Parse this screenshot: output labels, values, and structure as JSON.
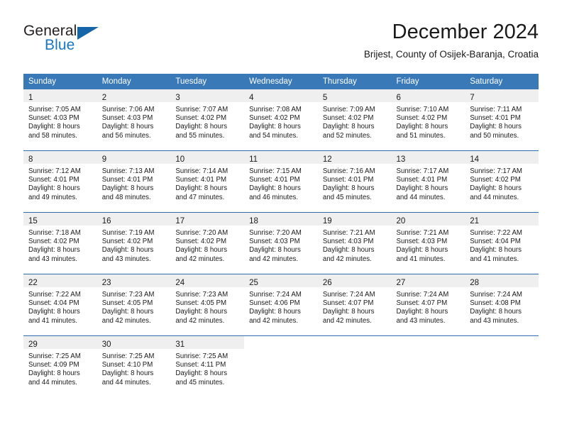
{
  "brand": {
    "name_part1": "General",
    "name_part2": "Blue",
    "logo_icon": "triangle-flag-icon",
    "accent_color": "#1878c4"
  },
  "header": {
    "month_title": "December 2024",
    "location": "Brijest, County of Osijek-Baranja, Croatia"
  },
  "theme": {
    "header_row_bg": "#3a79b8",
    "row_divider": "#2f6fad",
    "daynum_band_bg": "#efefef",
    "text_color": "#1a1a1a"
  },
  "calendar": {
    "weekday_headers": [
      "Sunday",
      "Monday",
      "Tuesday",
      "Wednesday",
      "Thursday",
      "Friday",
      "Saturday"
    ],
    "weeks": [
      [
        {
          "day": "1",
          "sunrise": "Sunrise: 7:05 AM",
          "sunset": "Sunset: 4:03 PM",
          "daylight_line1": "Daylight: 8 hours",
          "daylight_line2": "and 58 minutes."
        },
        {
          "day": "2",
          "sunrise": "Sunrise: 7:06 AM",
          "sunset": "Sunset: 4:03 PM",
          "daylight_line1": "Daylight: 8 hours",
          "daylight_line2": "and 56 minutes."
        },
        {
          "day": "3",
          "sunrise": "Sunrise: 7:07 AM",
          "sunset": "Sunset: 4:02 PM",
          "daylight_line1": "Daylight: 8 hours",
          "daylight_line2": "and 55 minutes."
        },
        {
          "day": "4",
          "sunrise": "Sunrise: 7:08 AM",
          "sunset": "Sunset: 4:02 PM",
          "daylight_line1": "Daylight: 8 hours",
          "daylight_line2": "and 54 minutes."
        },
        {
          "day": "5",
          "sunrise": "Sunrise: 7:09 AM",
          "sunset": "Sunset: 4:02 PM",
          "daylight_line1": "Daylight: 8 hours",
          "daylight_line2": "and 52 minutes."
        },
        {
          "day": "6",
          "sunrise": "Sunrise: 7:10 AM",
          "sunset": "Sunset: 4:02 PM",
          "daylight_line1": "Daylight: 8 hours",
          "daylight_line2": "and 51 minutes."
        },
        {
          "day": "7",
          "sunrise": "Sunrise: 7:11 AM",
          "sunset": "Sunset: 4:01 PM",
          "daylight_line1": "Daylight: 8 hours",
          "daylight_line2": "and 50 minutes."
        }
      ],
      [
        {
          "day": "8",
          "sunrise": "Sunrise: 7:12 AM",
          "sunset": "Sunset: 4:01 PM",
          "daylight_line1": "Daylight: 8 hours",
          "daylight_line2": "and 49 minutes."
        },
        {
          "day": "9",
          "sunrise": "Sunrise: 7:13 AM",
          "sunset": "Sunset: 4:01 PM",
          "daylight_line1": "Daylight: 8 hours",
          "daylight_line2": "and 48 minutes."
        },
        {
          "day": "10",
          "sunrise": "Sunrise: 7:14 AM",
          "sunset": "Sunset: 4:01 PM",
          "daylight_line1": "Daylight: 8 hours",
          "daylight_line2": "and 47 minutes."
        },
        {
          "day": "11",
          "sunrise": "Sunrise: 7:15 AM",
          "sunset": "Sunset: 4:01 PM",
          "daylight_line1": "Daylight: 8 hours",
          "daylight_line2": "and 46 minutes."
        },
        {
          "day": "12",
          "sunrise": "Sunrise: 7:16 AM",
          "sunset": "Sunset: 4:01 PM",
          "daylight_line1": "Daylight: 8 hours",
          "daylight_line2": "and 45 minutes."
        },
        {
          "day": "13",
          "sunrise": "Sunrise: 7:17 AM",
          "sunset": "Sunset: 4:01 PM",
          "daylight_line1": "Daylight: 8 hours",
          "daylight_line2": "and 44 minutes."
        },
        {
          "day": "14",
          "sunrise": "Sunrise: 7:17 AM",
          "sunset": "Sunset: 4:02 PM",
          "daylight_line1": "Daylight: 8 hours",
          "daylight_line2": "and 44 minutes."
        }
      ],
      [
        {
          "day": "15",
          "sunrise": "Sunrise: 7:18 AM",
          "sunset": "Sunset: 4:02 PM",
          "daylight_line1": "Daylight: 8 hours",
          "daylight_line2": "and 43 minutes."
        },
        {
          "day": "16",
          "sunrise": "Sunrise: 7:19 AM",
          "sunset": "Sunset: 4:02 PM",
          "daylight_line1": "Daylight: 8 hours",
          "daylight_line2": "and 43 minutes."
        },
        {
          "day": "17",
          "sunrise": "Sunrise: 7:20 AM",
          "sunset": "Sunset: 4:02 PM",
          "daylight_line1": "Daylight: 8 hours",
          "daylight_line2": "and 42 minutes."
        },
        {
          "day": "18",
          "sunrise": "Sunrise: 7:20 AM",
          "sunset": "Sunset: 4:03 PM",
          "daylight_line1": "Daylight: 8 hours",
          "daylight_line2": "and 42 minutes."
        },
        {
          "day": "19",
          "sunrise": "Sunrise: 7:21 AM",
          "sunset": "Sunset: 4:03 PM",
          "daylight_line1": "Daylight: 8 hours",
          "daylight_line2": "and 42 minutes."
        },
        {
          "day": "20",
          "sunrise": "Sunrise: 7:21 AM",
          "sunset": "Sunset: 4:03 PM",
          "daylight_line1": "Daylight: 8 hours",
          "daylight_line2": "and 41 minutes."
        },
        {
          "day": "21",
          "sunrise": "Sunrise: 7:22 AM",
          "sunset": "Sunset: 4:04 PM",
          "daylight_line1": "Daylight: 8 hours",
          "daylight_line2": "and 41 minutes."
        }
      ],
      [
        {
          "day": "22",
          "sunrise": "Sunrise: 7:22 AM",
          "sunset": "Sunset: 4:04 PM",
          "daylight_line1": "Daylight: 8 hours",
          "daylight_line2": "and 41 minutes."
        },
        {
          "day": "23",
          "sunrise": "Sunrise: 7:23 AM",
          "sunset": "Sunset: 4:05 PM",
          "daylight_line1": "Daylight: 8 hours",
          "daylight_line2": "and 42 minutes."
        },
        {
          "day": "24",
          "sunrise": "Sunrise: 7:23 AM",
          "sunset": "Sunset: 4:05 PM",
          "daylight_line1": "Daylight: 8 hours",
          "daylight_line2": "and 42 minutes."
        },
        {
          "day": "25",
          "sunrise": "Sunrise: 7:24 AM",
          "sunset": "Sunset: 4:06 PM",
          "daylight_line1": "Daylight: 8 hours",
          "daylight_line2": "and 42 minutes."
        },
        {
          "day": "26",
          "sunrise": "Sunrise: 7:24 AM",
          "sunset": "Sunset: 4:07 PM",
          "daylight_line1": "Daylight: 8 hours",
          "daylight_line2": "and 42 minutes."
        },
        {
          "day": "27",
          "sunrise": "Sunrise: 7:24 AM",
          "sunset": "Sunset: 4:07 PM",
          "daylight_line1": "Daylight: 8 hours",
          "daylight_line2": "and 43 minutes."
        },
        {
          "day": "28",
          "sunrise": "Sunrise: 7:24 AM",
          "sunset": "Sunset: 4:08 PM",
          "daylight_line1": "Daylight: 8 hours",
          "daylight_line2": "and 43 minutes."
        }
      ],
      [
        {
          "day": "29",
          "sunrise": "Sunrise: 7:25 AM",
          "sunset": "Sunset: 4:09 PM",
          "daylight_line1": "Daylight: 8 hours",
          "daylight_line2": "and 44 minutes."
        },
        {
          "day": "30",
          "sunrise": "Sunrise: 7:25 AM",
          "sunset": "Sunset: 4:10 PM",
          "daylight_line1": "Daylight: 8 hours",
          "daylight_line2": "and 44 minutes."
        },
        {
          "day": "31",
          "sunrise": "Sunrise: 7:25 AM",
          "sunset": "Sunset: 4:11 PM",
          "daylight_line1": "Daylight: 8 hours",
          "daylight_line2": "and 45 minutes."
        },
        {
          "day": "",
          "sunrise": "",
          "sunset": "",
          "daylight_line1": "",
          "daylight_line2": ""
        },
        {
          "day": "",
          "sunrise": "",
          "sunset": "",
          "daylight_line1": "",
          "daylight_line2": ""
        },
        {
          "day": "",
          "sunrise": "",
          "sunset": "",
          "daylight_line1": "",
          "daylight_line2": ""
        },
        {
          "day": "",
          "sunrise": "",
          "sunset": "",
          "daylight_line1": "",
          "daylight_line2": ""
        }
      ]
    ]
  }
}
